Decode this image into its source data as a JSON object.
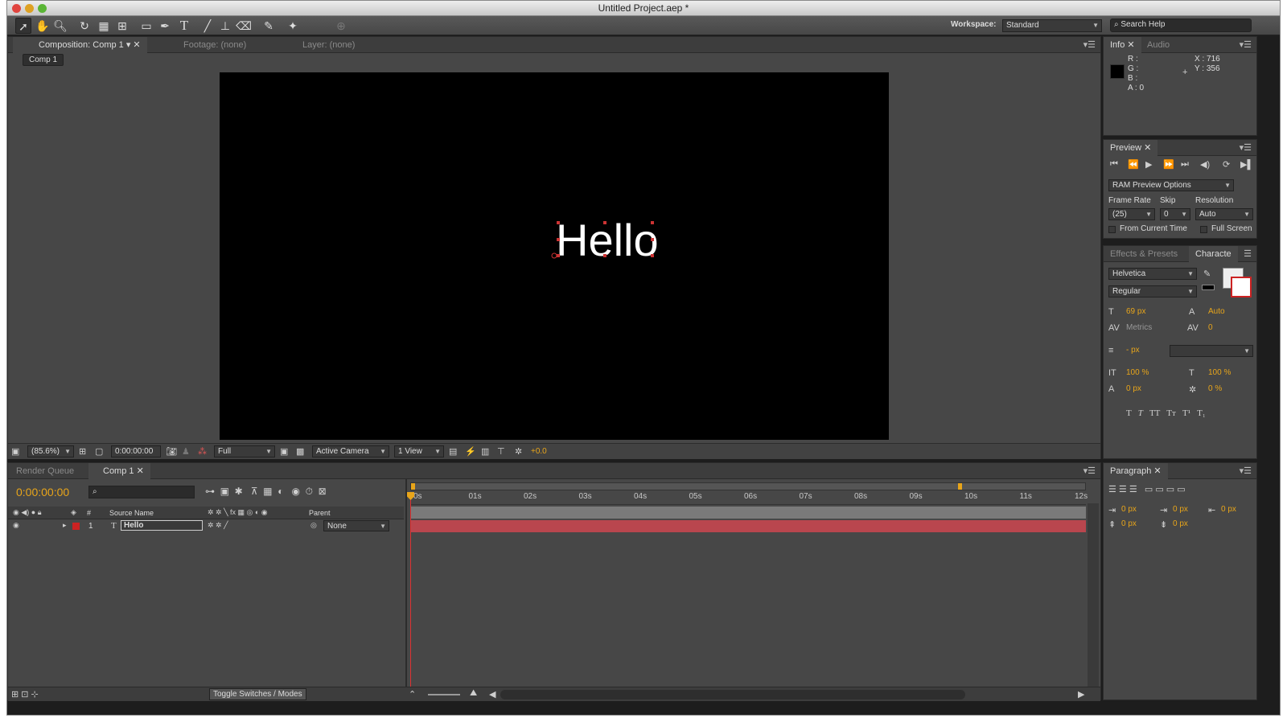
{
  "window": {
    "title": "Untitled Project.aep *"
  },
  "toolbar": {
    "workspace_label": "Workspace:",
    "workspace_value": "Standard",
    "search_placeholder": "Search Help"
  },
  "comp_panel": {
    "tab_comp": "Composition: Comp 1",
    "tab_footage": "Footage: (none)",
    "tab_layer": "Layer: (none)",
    "breadcrumb": "Comp 1",
    "canvas_text": "Hello",
    "zoom": "(85.6%)",
    "timecode": "0:00:00:00",
    "resolution": "Full",
    "camera": "Active Camera",
    "views": "1 View",
    "exposure": "+0.0"
  },
  "info_panel": {
    "tab_info": "Info",
    "tab_audio": "Audio",
    "r": "R :",
    "g": "G :",
    "b": "B :",
    "a": "A : 0",
    "x": "X : 716",
    "y": "Y : 356"
  },
  "preview_panel": {
    "tab": "Preview",
    "ram_options": "RAM Preview Options",
    "frame_rate_label": "Frame Rate",
    "skip_label": "Skip",
    "resolution_label": "Resolution",
    "frame_rate_value": "(25)",
    "skip_value": "0",
    "resolution_value": "Auto",
    "from_current": "From Current Time",
    "full_screen": "Full Screen"
  },
  "character_panel": {
    "tab_effects": "Effects & Presets",
    "tab_character": "Characte",
    "font": "Helvetica",
    "style": "Regular",
    "size": "69 px",
    "leading": "Auto",
    "kerning": "Metrics",
    "tracking": "0",
    "stroke": "- px",
    "vscale": "100 %",
    "hscale": "100 %",
    "baseline": "0 px",
    "tsume": "0 %"
  },
  "timeline": {
    "tab_render": "Render Queue",
    "tab_comp": "Comp 1",
    "timecode": "0:00:00:00",
    "col_num": "#",
    "col_source": "Source Name",
    "col_parent": "Parent",
    "layer_num": "1",
    "layer_name": "Hello",
    "parent_value": "None",
    "toggle": "Toggle Switches / Modes",
    "ruler": [
      "0s",
      "01s",
      "02s",
      "03s",
      "04s",
      "05s",
      "06s",
      "07s",
      "08s",
      "09s",
      "10s",
      "11s",
      "12s"
    ]
  },
  "paragraph_panel": {
    "tab": "Paragraph",
    "indent_left": "0 px",
    "indent_first": "0 px",
    "indent_right": "0 px",
    "space_before": "0 px",
    "space_after": "0 px"
  }
}
